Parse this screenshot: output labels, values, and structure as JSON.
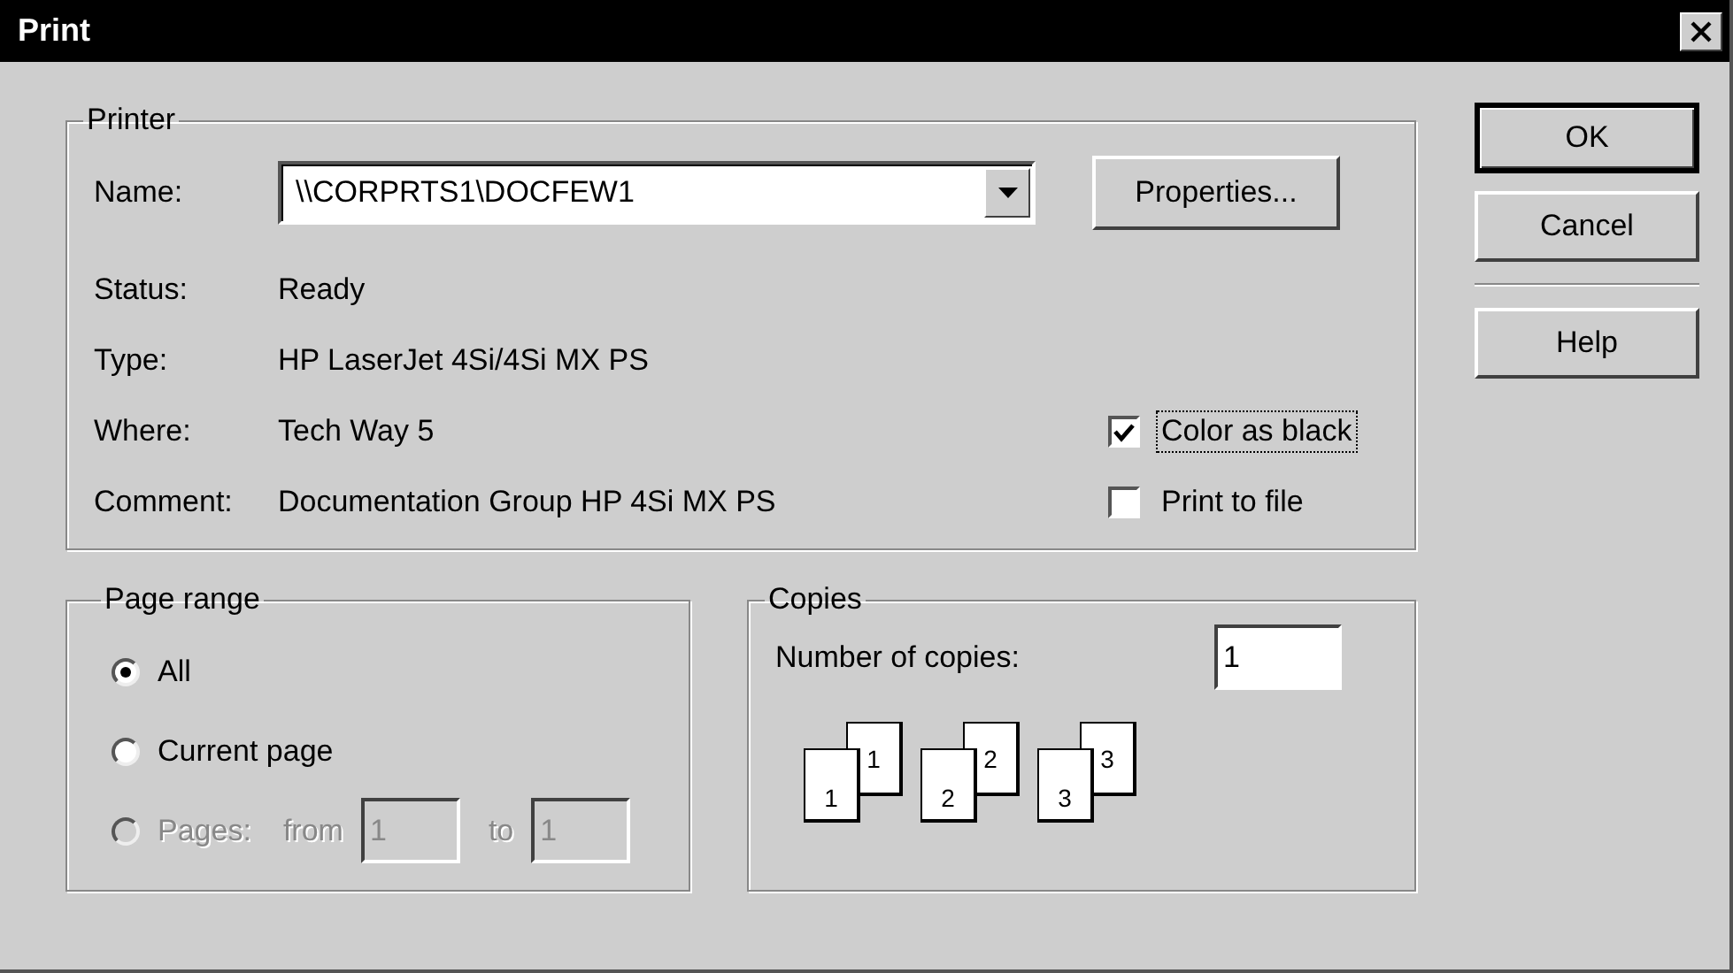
{
  "window": {
    "title": "Print"
  },
  "printer": {
    "group_label": "Printer",
    "name_label": "Name:",
    "name_value": "\\\\CORPRTS1\\DOCFEW1",
    "properties_button": "Properties...",
    "info": [
      {
        "label": "Status:",
        "value": "Ready"
      },
      {
        "label": "Type:",
        "value": "HP LaserJet 4Si/4Si MX PS"
      },
      {
        "label": "Where:",
        "value": "Tech Way 5"
      },
      {
        "label": "Comment:",
        "value": "Documentation Group HP 4Si MX PS"
      }
    ],
    "options": [
      {
        "label": "Color as black",
        "checked": true,
        "focused": true
      },
      {
        "label": "Print to file",
        "checked": false,
        "focused": false
      }
    ]
  },
  "page_range": {
    "group_label": "Page range",
    "options": [
      {
        "kind": "radio",
        "label": "All",
        "selected": true,
        "disabled": false
      },
      {
        "kind": "radio",
        "label": "Current page",
        "selected": false,
        "disabled": false
      },
      {
        "kind": "range",
        "label": "Pages:",
        "selected": false,
        "disabled": true,
        "from_label": "from",
        "from_value": "1",
        "to_label": "to",
        "to_value": "1"
      }
    ]
  },
  "copies": {
    "group_label": "Copies",
    "count_label": "Number of copies:",
    "count_value": "1",
    "collate": [
      [
        "1",
        "1"
      ],
      [
        "2",
        "2"
      ],
      [
        "3",
        "3"
      ]
    ]
  },
  "buttons": [
    {
      "kind": "button",
      "label": "OK",
      "default": true
    },
    {
      "kind": "button",
      "label": "Cancel",
      "default": false
    },
    {
      "kind": "separator"
    },
    {
      "kind": "button",
      "label": "Help",
      "default": false
    }
  ]
}
